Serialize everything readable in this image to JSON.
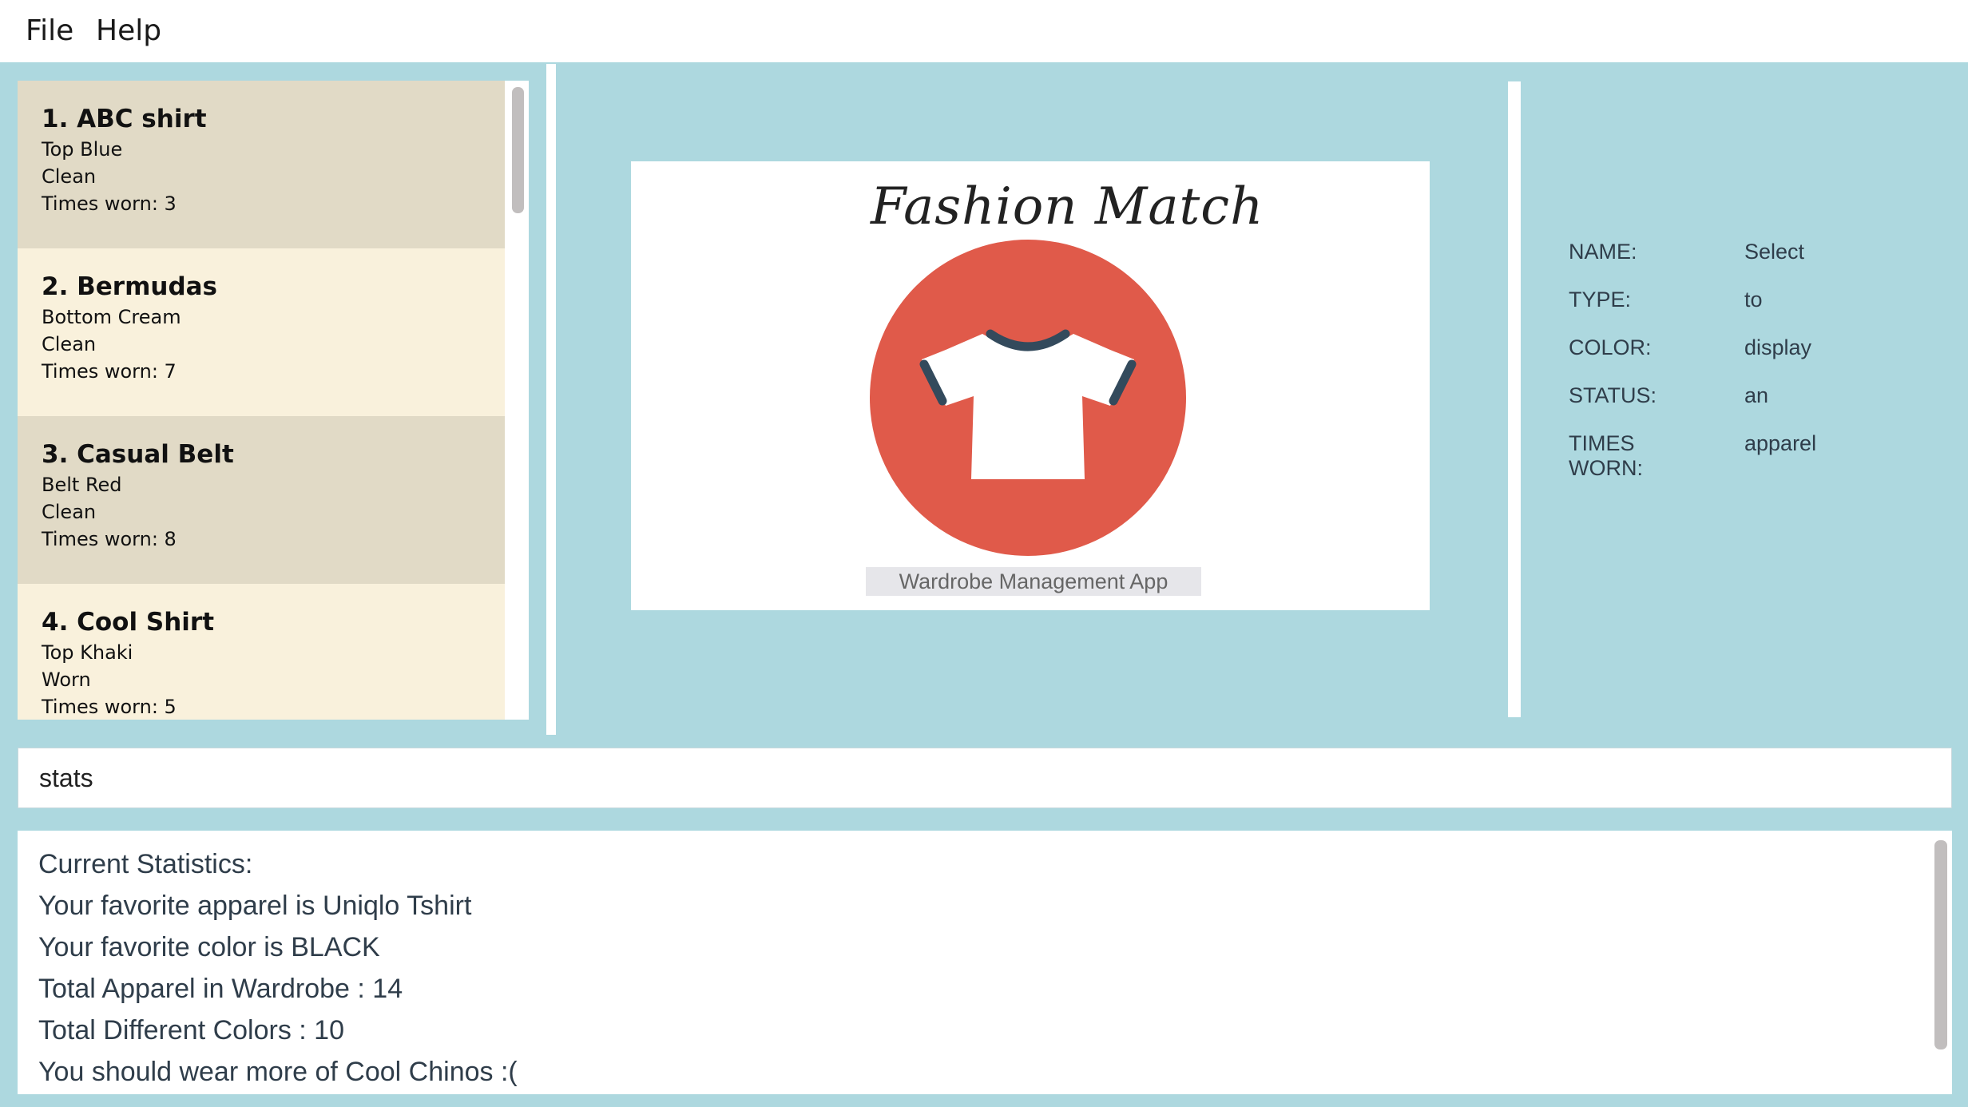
{
  "menu": {
    "file_label": "File",
    "help_label": "Help"
  },
  "apparel_list": [
    {
      "index_name": "1.  ABC shirt",
      "type_color": "Top  Blue",
      "status": "Clean",
      "times_worn": "Times worn: 3"
    },
    {
      "index_name": "2.  Bermudas",
      "type_color": "Bottom  Cream",
      "status": "Clean",
      "times_worn": "Times worn: 7"
    },
    {
      "index_name": "3.  Casual Belt",
      "type_color": "Belt  Red",
      "status": "Clean",
      "times_worn": "Times worn: 8"
    },
    {
      "index_name": "4.  Cool Shirt",
      "type_color": "Top  Khaki",
      "status": "Worn",
      "times_worn": "Times worn: 5"
    }
  ],
  "logo": {
    "script_title": "Fashion Match",
    "subtitle": "Wardrobe Management App"
  },
  "details": [
    {
      "label": "NAME:",
      "value": "Select"
    },
    {
      "label": "TYPE:",
      "value": "to"
    },
    {
      "label": "COLOR:",
      "value": "display"
    },
    {
      "label": "STATUS:",
      "value": "an"
    },
    {
      "label": "TIMES WORN:",
      "value": "apparel"
    }
  ],
  "command": {
    "value": "stats"
  },
  "result": {
    "lines": [
      "Current Statistics:",
      "Your favorite apparel is Uniqlo Tshirt",
      "Your favorite color is BLACK",
      "Total Apparel in Wardrobe : 14",
      "Total Different Colors : 10",
      "You should wear more of Cool Chinos :("
    ]
  },
  "colors": {
    "background": "#add8df",
    "card_odd": "#e1dac6",
    "card_even": "#f9f1dc",
    "logo_circle": "#e05a4a",
    "logo_trim": "#334a5c"
  }
}
